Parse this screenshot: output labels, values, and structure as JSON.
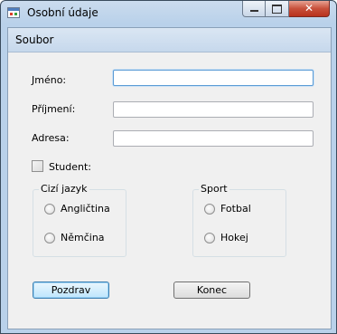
{
  "window": {
    "title": "Osobní údaje"
  },
  "menu": {
    "file": "Soubor"
  },
  "form": {
    "name_label": "Jméno:",
    "surname_label": "Příjmení:",
    "address_label": "Adresa:",
    "name_value": "",
    "surname_value": "",
    "address_value": "",
    "student_label": "Student:"
  },
  "language_group": {
    "title": "Cizí jazyk",
    "options": [
      "Angličtina",
      "Němčina"
    ]
  },
  "sport_group": {
    "title": "Sport",
    "options": [
      "Fotbal",
      "Hokej"
    ]
  },
  "buttons": {
    "greet": "Pozdrav",
    "end": "Konec"
  },
  "icons": {
    "minimize": "minimize-icon",
    "maximize": "maximize-icon",
    "close": "close-icon",
    "app": "form-app-icon"
  }
}
